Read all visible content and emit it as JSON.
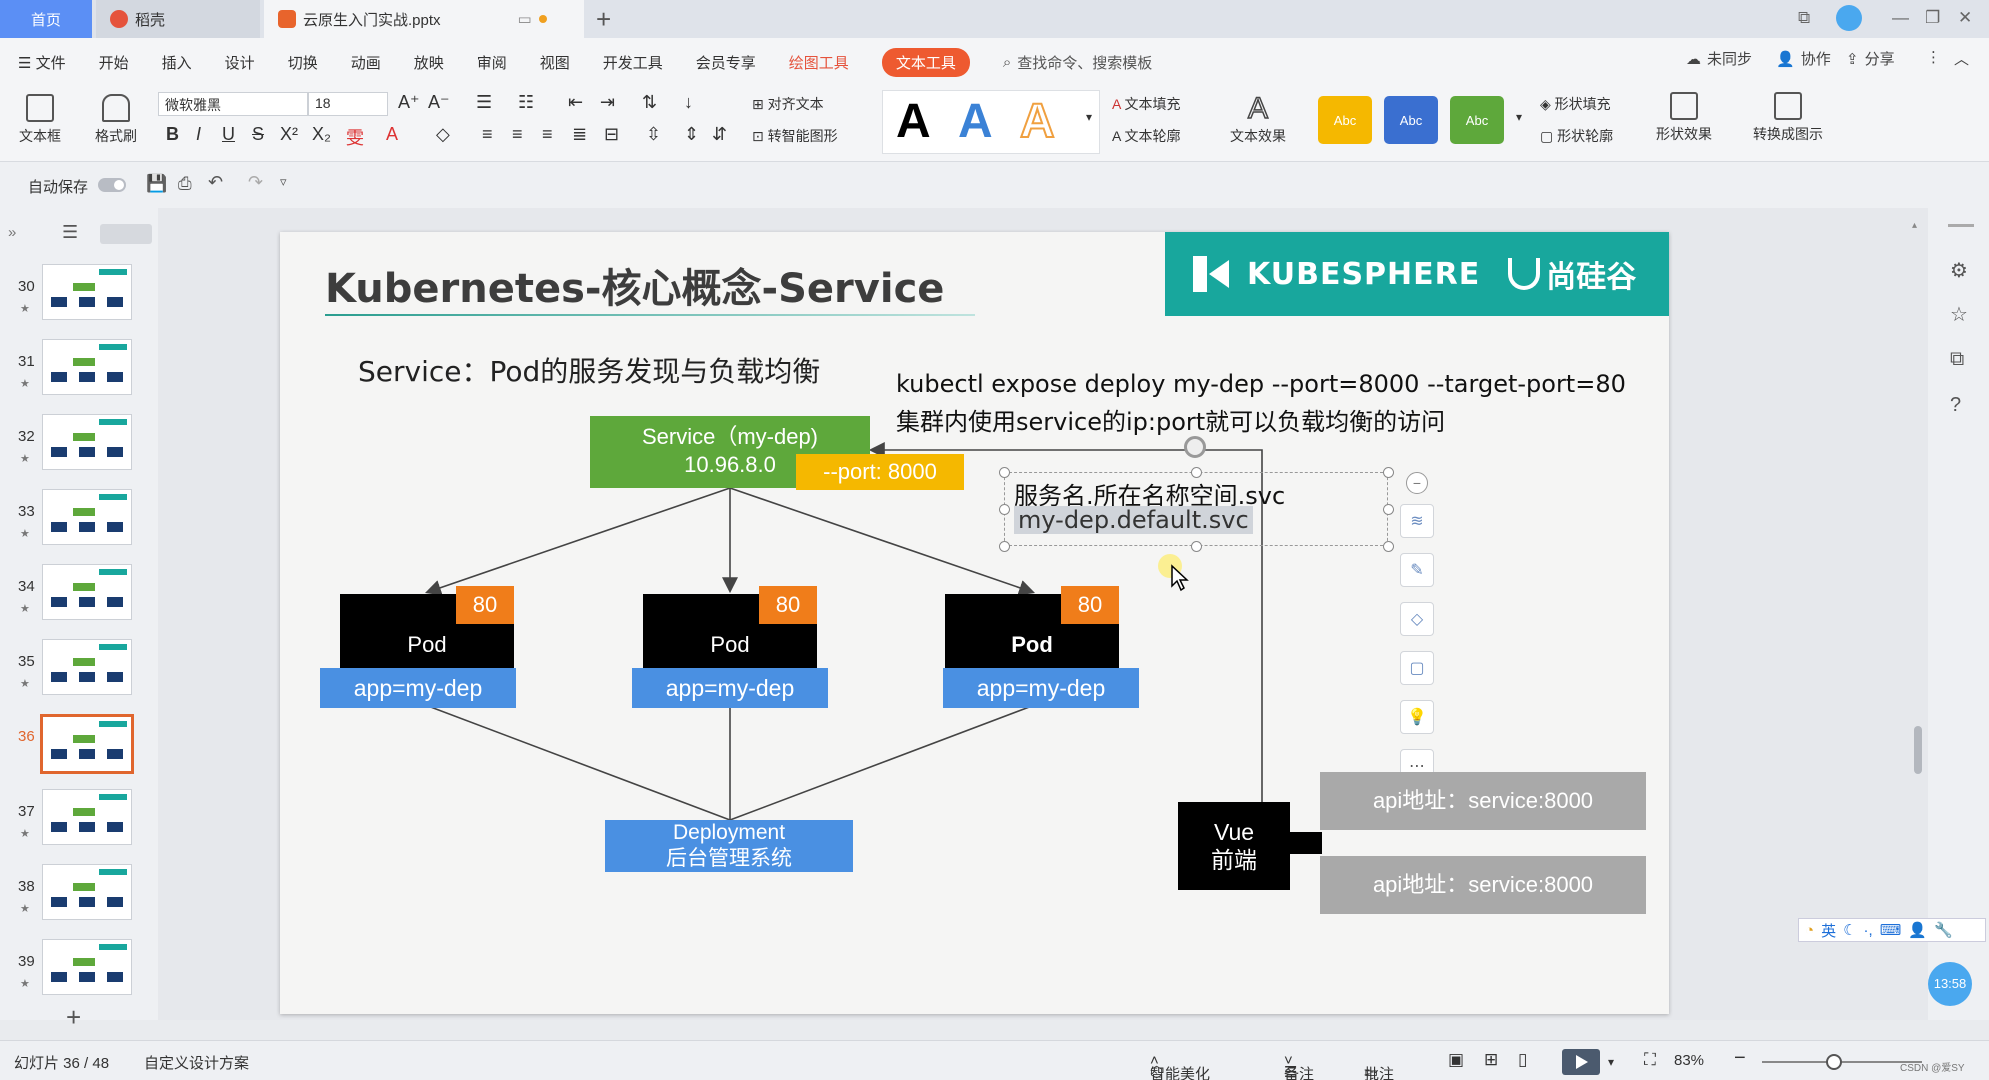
{
  "tabs": {
    "home": "首页",
    "shell": "稻壳",
    "doc": "云原生入门实战.pptx"
  },
  "menu": {
    "file": "文件",
    "items": [
      "开始",
      "插入",
      "设计",
      "切换",
      "动画",
      "放映",
      "审阅",
      "视图",
      "开发工具",
      "会员专享"
    ],
    "draw_tools": "绘图工具",
    "text_tools": "文本工具",
    "search": "查找命令、搜索模板",
    "unsynced": "未同步",
    "collab": "协作",
    "share": "分享"
  },
  "ribbon": {
    "textbox": "文本框",
    "format_painter": "格式刷",
    "font_name": "微软雅黑",
    "font_size": "18",
    "align_text": "对齐文本",
    "to_smartart": "转智能图形",
    "text_fill": "文本填充",
    "text_outline": "文本轮廓",
    "text_effect": "文本效果",
    "shape_fill": "形状填充",
    "shape_outline": "形状轮廓",
    "shape_effect": "形状效果",
    "convert_diagram": "转换成图示",
    "abc": "Abc",
    "style_colors": [
      "#000000",
      "#3b82d6",
      "#f0a040"
    ],
    "swatch_colors": [
      "#f5b800",
      "#3a6fd0",
      "#5ea83b"
    ]
  },
  "quick": {
    "autosave": "自动保存"
  },
  "thumbnails": [
    {
      "num": "30",
      "active": false
    },
    {
      "num": "31",
      "active": false
    },
    {
      "num": "32",
      "active": false
    },
    {
      "num": "33",
      "active": false
    },
    {
      "num": "34",
      "active": false
    },
    {
      "num": "35",
      "active": false
    },
    {
      "num": "36",
      "active": true
    },
    {
      "num": "37",
      "active": false
    },
    {
      "num": "38",
      "active": false
    },
    {
      "num": "39",
      "active": false
    }
  ],
  "slide": {
    "title": "Kubernetes-核心概念-Service",
    "banner_brand": "KUBESPHERE",
    "banner_partner": "尚硅谷",
    "subtitle": "Service：Pod的服务发现与负载均衡",
    "command": "kubectl expose deploy my-dep --port=8000 --target-port=80",
    "note": "集群内使用service的ip:port就可以负载均衡的访问",
    "service_line1": "Service（my-dep)",
    "service_line2": "10.96.8.0",
    "port_tag": "--port: 8000",
    "pods": [
      {
        "label": "Pod",
        "port": "80",
        "app": "app=my-dep"
      },
      {
        "label": "Pod",
        "port": "80",
        "app": "app=my-dep"
      },
      {
        "label": "Pod",
        "port": "80",
        "app": "app=my-dep"
      }
    ],
    "deployment_line1": "Deployment",
    "deployment_line2": "后台管理系统",
    "dns_line1": "服务名.所在名称空间.svc",
    "dns_line2": "my-dep.default.svc",
    "vue_line1": "Vue",
    "vue_line2": "前端",
    "api1": "api地址：service:8000",
    "api2": "api地址：service:8000"
  },
  "ime": {
    "lang": "英"
  },
  "clock": "13:58",
  "status": {
    "slide_counter": "幻灯片 36 / 48",
    "design": "自定义设计方案",
    "beautify": "智能美化",
    "notes": "备注",
    "comments": "批注",
    "zoom": "83%",
    "watermark": "CSDN @爱SY"
  }
}
